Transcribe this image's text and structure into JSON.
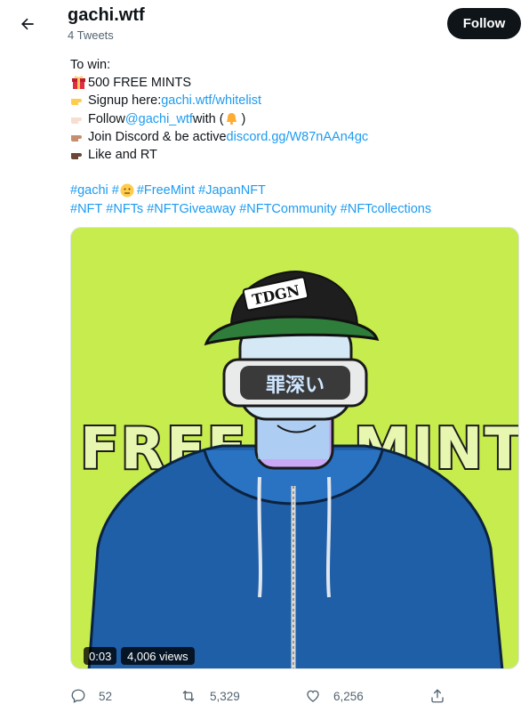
{
  "header": {
    "back_icon": "arrow-left-icon",
    "title": "gachi.wtf",
    "subtitle": "4 Tweets",
    "follow_label": "Follow"
  },
  "tweet": {
    "line1": "To win:",
    "line2_text": "500 FREE MINTS",
    "line3_text": "Signup here: ",
    "line3_link": "gachi.wtf/whitelist",
    "line4_text_a": "Follow ",
    "line4_link": "@gachi_wtf",
    "line4_text_b": " with (",
    "line4_text_c": ")",
    "line5_text": "Join Discord & be active ",
    "line5_link": "discord.gg/W87nAAn4gc",
    "line6_text": "Like and RT",
    "hashtags1": [
      "#gachi",
      "#",
      "#FreeMint",
      "#JapanNFT"
    ],
    "hashtags2": [
      "#NFT",
      "#NFTs",
      "#NFTGiveaway",
      "#NFTCommunity",
      "#NFTcollections"
    ]
  },
  "media": {
    "cap_text": "TDGN",
    "visor_text": "罪深い",
    "overlay_left": "FREE",
    "overlay_right": "MINT",
    "video_time": "0:03",
    "video_views": "4,006 views",
    "background_color": "#c6ec4e"
  },
  "actions": {
    "reply_count": "52",
    "retweet_count": "5,329",
    "like_count": "6,256"
  },
  "colors": {
    "link": "#1d9bf0",
    "follow_bg": "#0f1419",
    "muted": "#536471"
  }
}
